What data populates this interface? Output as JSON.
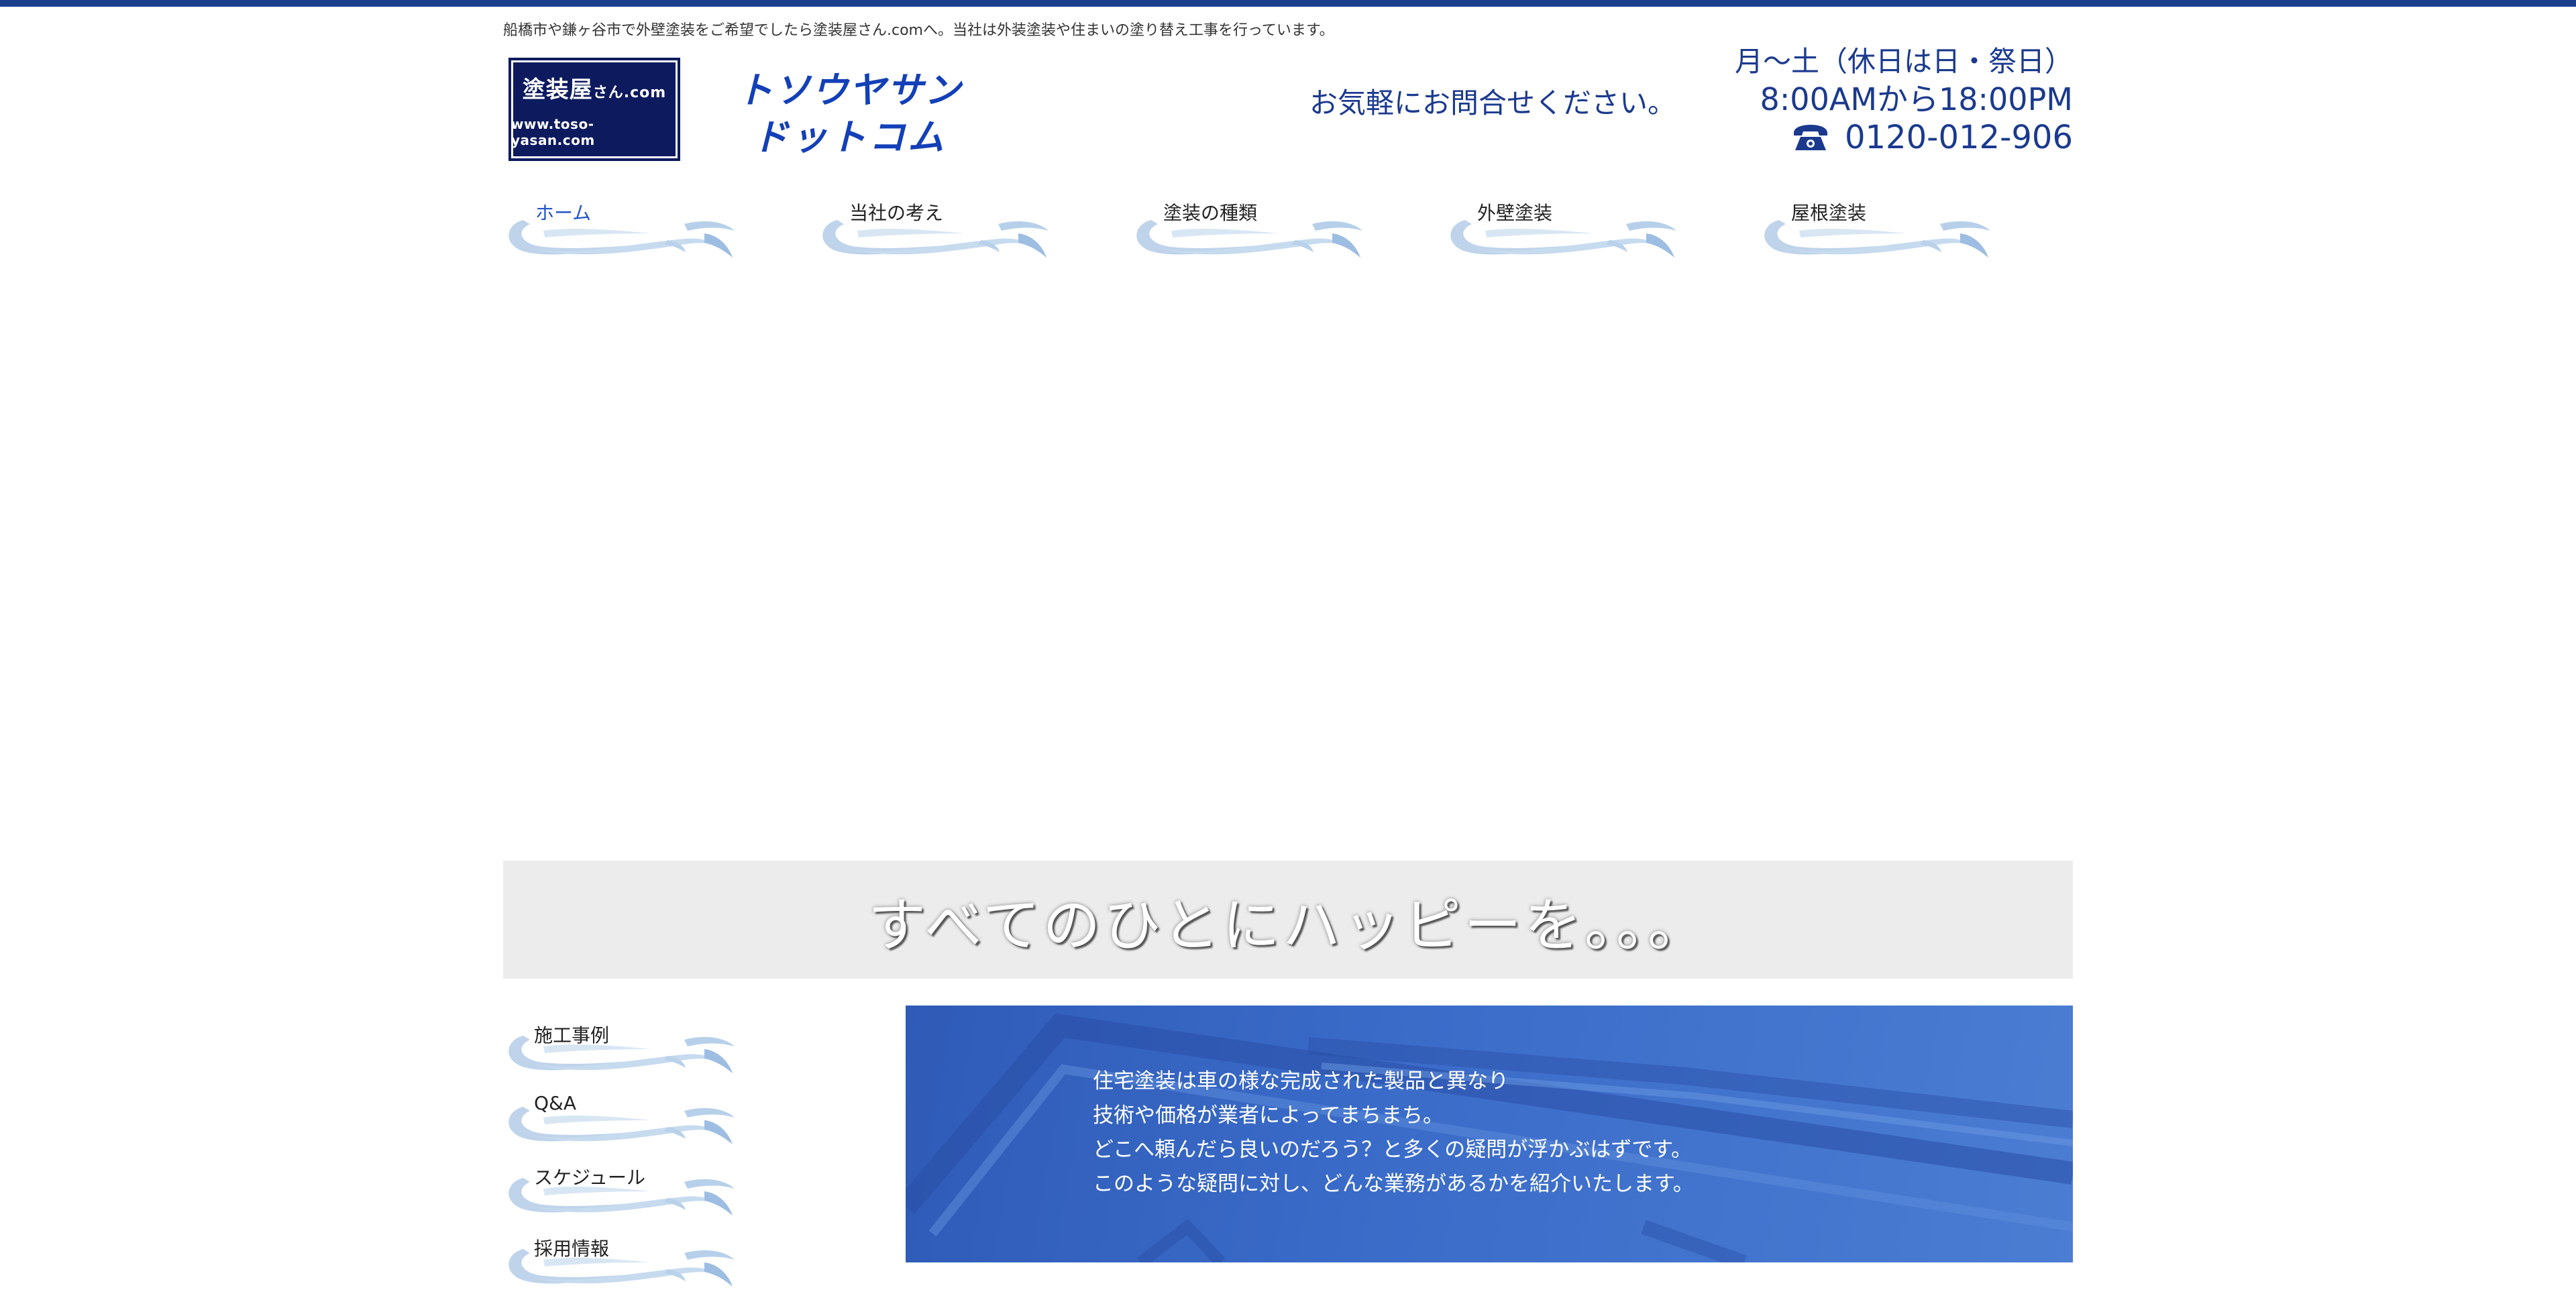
{
  "header": {
    "tagline": "船橋市や鎌ヶ谷市で外壁塗装をご希望でしたら塗装屋さん.comへ。当社は外装塗装や住まいの塗り替え工事を行っています。",
    "logo_line1": "塗装屋",
    "logo_line1_small": "さん.com",
    "logo_line2": "www.toso-yasan.com",
    "logo_kana_line1": "トソウヤサン",
    "logo_kana_line2": "ドットコム",
    "contact_lead": "お気軽にお問合せください。",
    "hours_days": "月〜土（休日は日・祭日）",
    "hours_time": "8:00AMから18:00PM",
    "phone": "0120-012-906"
  },
  "nav": {
    "items": [
      {
        "label": "ホーム"
      },
      {
        "label": "当社の考え"
      },
      {
        "label": "塗装の種類"
      },
      {
        "label": "外壁塗装"
      },
      {
        "label": "屋根塗装"
      }
    ]
  },
  "banner": {
    "text": "すべてのひとにハッピーを。。。"
  },
  "sidebar": {
    "items": [
      {
        "label": "施工事例"
      },
      {
        "label": "Q&A"
      },
      {
        "label": "スケジュール"
      },
      {
        "label": "採用情報"
      }
    ]
  },
  "intro": {
    "lines": [
      "住宅塗装は車の様な完成された製品と異なり",
      "技術や価格が業者によってまちまち。",
      "どこへ頼んだら良いのだろう？と多くの疑問が浮かぶはずです。",
      "このような疑問に対し、どんな業務があるかを紹介いたします。"
    ]
  },
  "colors": {
    "brand_navy": "#0d1a5e",
    "brand_blue": "#1340b8",
    "contact_blue": "#1b3a8e",
    "active_nav": "#2255c4",
    "panel_blue": "#3a6bc8"
  }
}
